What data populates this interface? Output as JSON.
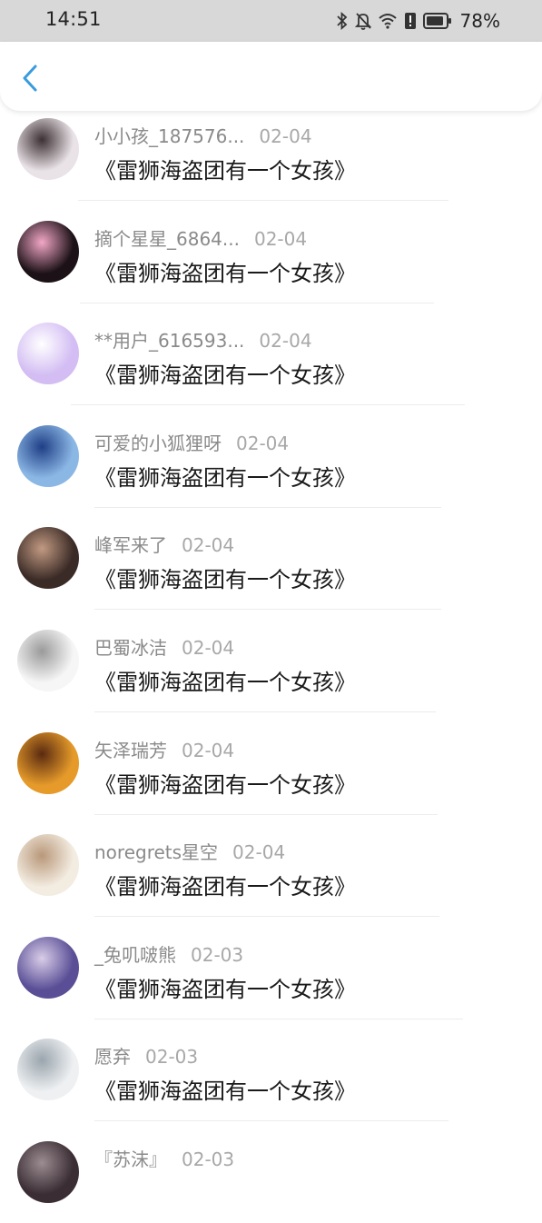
{
  "status_bar": {
    "time": "14:51",
    "battery": "78%",
    "icons": [
      "bluetooth-icon",
      "bell-muted-icon",
      "wifi-icon",
      "alert-icon",
      "battery-icon"
    ]
  },
  "header": {
    "back_icon": "chevron-left-icon",
    "accent_color": "#3a9bde"
  },
  "list": {
    "items": [
      {
        "name": "小小孩_187576...",
        "date": "02-04",
        "content": "《雷狮海盗团有一个女孩》",
        "avatar_palette": [
          "#e9e2e6",
          "#3c3034"
        ]
      },
      {
        "name": "摘个星星_6864...",
        "date": "02-04",
        "content": "《雷狮海盗团有一个女孩》",
        "avatar_palette": [
          "#1b1116",
          "#f2a7c6"
        ]
      },
      {
        "name": "**用户_616593...",
        "date": "02-04",
        "content": "《雷狮海盗团有一个女孩》",
        "avatar_palette": [
          "#d3bdf3",
          "#ffffff"
        ]
      },
      {
        "name": "可爱的小狐狸呀",
        "date": "02-04",
        "content": "《雷狮海盗团有一个女孩》",
        "avatar_palette": [
          "#8bb7e5",
          "#1f3f86"
        ]
      },
      {
        "name": "峰军来了",
        "date": "02-04",
        "content": "《雷狮海盗团有一个女孩》",
        "avatar_palette": [
          "#3b2b27",
          "#c29a82"
        ]
      },
      {
        "name": "巴蜀冰洁",
        "date": "02-04",
        "content": "《雷狮海盗团有一个女孩》",
        "avatar_palette": [
          "#f6f6f6",
          "#9a9a9a"
        ]
      },
      {
        "name": "矢泽瑞芳",
        "date": "02-04",
        "content": "《雷狮海盗团有一个女孩》",
        "avatar_palette": [
          "#e59a2a",
          "#5a2a10"
        ]
      },
      {
        "name": "noregrets星空",
        "date": "02-04",
        "content": "《雷狮海盗团有一个女孩》",
        "avatar_palette": [
          "#f3ece1",
          "#b9987a"
        ]
      },
      {
        "name": "_兔叽啵熊",
        "date": "02-03",
        "content": "《雷狮海盗团有一个女孩》",
        "avatar_palette": [
          "#5a4f96",
          "#d9cde8"
        ]
      },
      {
        "name": "愿弃",
        "date": "02-03",
        "content": "《雷狮海盗团有一个女孩》",
        "avatar_palette": [
          "#eef0f2",
          "#9aa5ad"
        ]
      },
      {
        "name": "『苏沫』",
        "date": "02-03",
        "content": "",
        "avatar_palette": [
          "#3a2d33",
          "#9b8d92"
        ]
      }
    ]
  }
}
